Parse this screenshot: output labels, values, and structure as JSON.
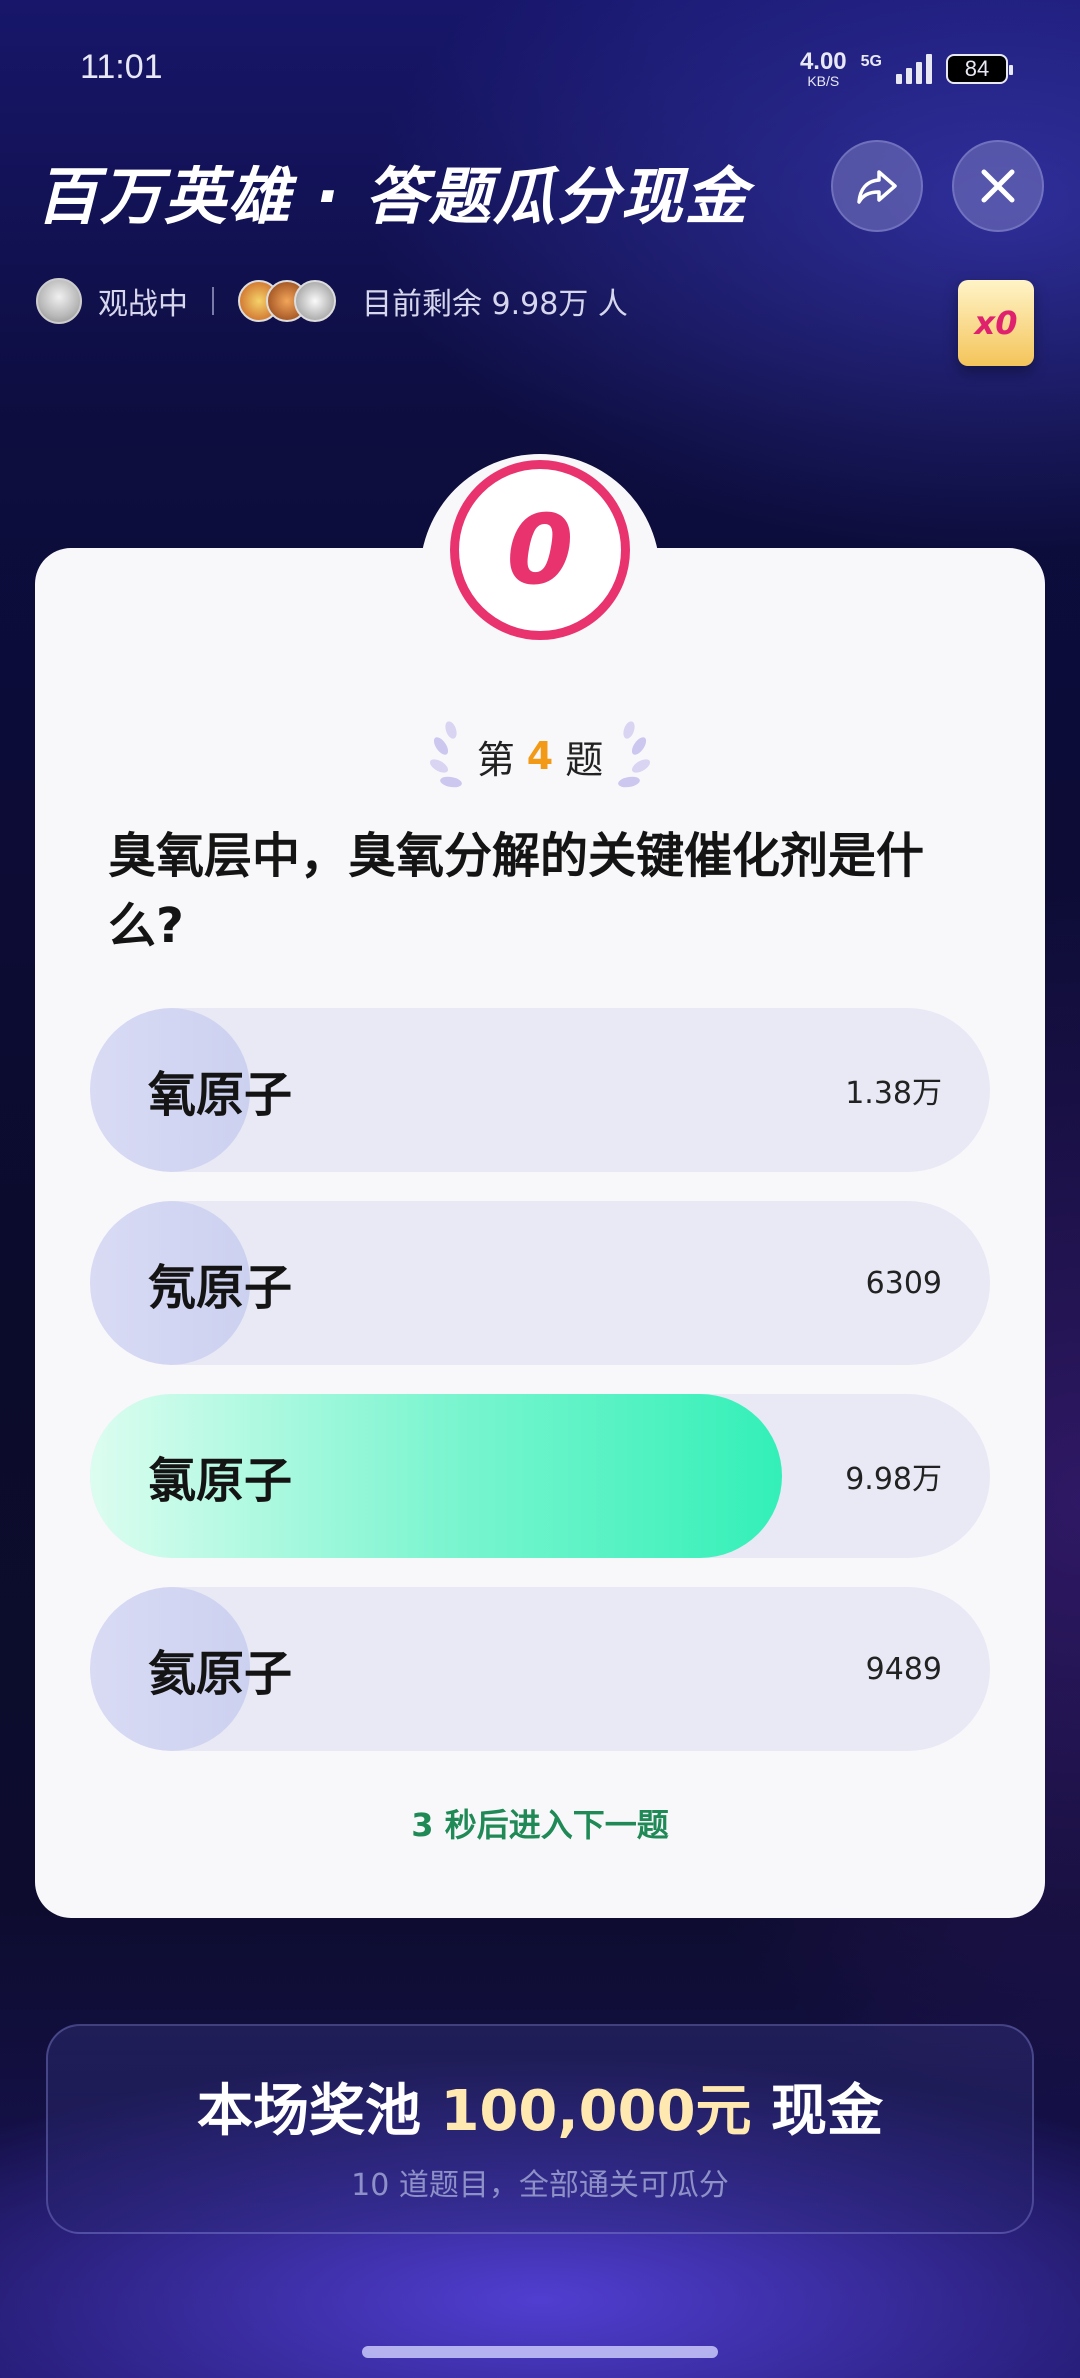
{
  "status_bar": {
    "time": "11:01",
    "net_speed": "4.00",
    "net_unit": "KB/S",
    "net_type": "5G",
    "battery": "84"
  },
  "header": {
    "title": "百万英雄 · 答题瓜分现金",
    "share_icon": "share-arrow-icon",
    "close_icon": "close-icon"
  },
  "viewers": {
    "watching_label": "观战中",
    "remaining_prefix": "目前剩余",
    "remaining_count": "9.98万",
    "remaining_suffix": "人",
    "remaining_text": "目前剩余 9.98万 人"
  },
  "multiplier": "x0",
  "timer": "0",
  "question": {
    "prefix": "第",
    "number": "4",
    "suffix": "题",
    "text": "臭氧层中，臭氧分解的关键催化剂是什么?"
  },
  "options": [
    {
      "label": "氧原子",
      "count": "1.38万",
      "fraction": 0.138
    },
    {
      "label": "氖原子",
      "count": "6309",
      "fraction": 0.063
    },
    {
      "label": "氯原子",
      "count": "9.98万",
      "fraction": 0.77,
      "correct": true
    },
    {
      "label": "氦原子",
      "count": "9489",
      "fraction": 0.095
    }
  ],
  "next_hint": "3 秒后进入下一题",
  "prize": {
    "prefix": "本场奖池",
    "amount": "100,000元",
    "suffix": "现金",
    "subtitle": "10 道题目，全部通关可瓜分"
  },
  "colors": {
    "timer_accent": "#e8336f",
    "correct_fill": "#33f0b8",
    "question_number": "#f29a18",
    "hint_text": "#1f8a56"
  }
}
